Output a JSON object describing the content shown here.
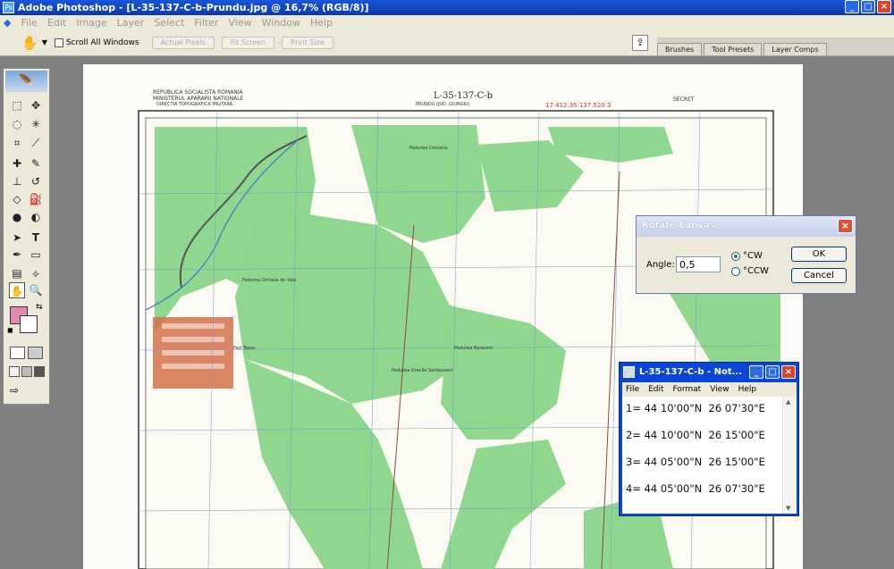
{
  "window": {
    "title": "Adobe Photoshop - [L-35-137-C-b-Prundu.jpg @ 16,7% (RGB/8)]"
  },
  "menu": [
    "File",
    "Edit",
    "Image",
    "Layer",
    "Select",
    "Filter",
    "View",
    "Window",
    "Help"
  ],
  "options": {
    "scroll_all": "Scroll All Windows",
    "actual_pixels": "Actual Pixels",
    "fit_screen": "Fit Screen",
    "print_size": "Print Size"
  },
  "palette_tabs": [
    "Brushes",
    "Tool Presets",
    "Layer Comps"
  ],
  "map": {
    "header_left1": "REPUBLICA SOCIALISTA ROMANIA",
    "header_left2": "MINISTERUL APARARII NATIONALE",
    "header_left3": "DIRECTIA TOPOGRAFICA MILITARA",
    "sheet": "L-35-137-C-b",
    "sheet_sub": "PRUNDU (JUD. GIURGIU)",
    "code": "17 412.35.137.520.3",
    "secret": "SECRET",
    "labels": [
      "Padurea Comana",
      "Padurea Ortoaia de Vale",
      "Pad Tepes",
      "Padurea Grecila Sambuseni",
      "Padurea Balaceni"
    ]
  },
  "rotate": {
    "title": "Rotate Canvas",
    "angle_label": "Angle:",
    "angle_value": "0,5",
    "cw": "°CW",
    "ccw": "°CCW",
    "ok": "OK",
    "cancel": "Cancel"
  },
  "notepad": {
    "title": "L-35-137-C-b - Not...",
    "menu": [
      "File",
      "Edit",
      "Format",
      "View",
      "Help"
    ],
    "lines": [
      "1= 44 10'00\"N  26 07'30\"E",
      "2= 44 10'00\"N  26 15'00\"E",
      "3= 44 05'00\"N  26 15'00\"E",
      "4= 44 05'00\"N  26 07'30\"E"
    ]
  },
  "colors": {
    "accent": "#0a46d8",
    "map_green": "#8fd68f",
    "town": "#d4704a",
    "foreground": "#e08ab0"
  }
}
